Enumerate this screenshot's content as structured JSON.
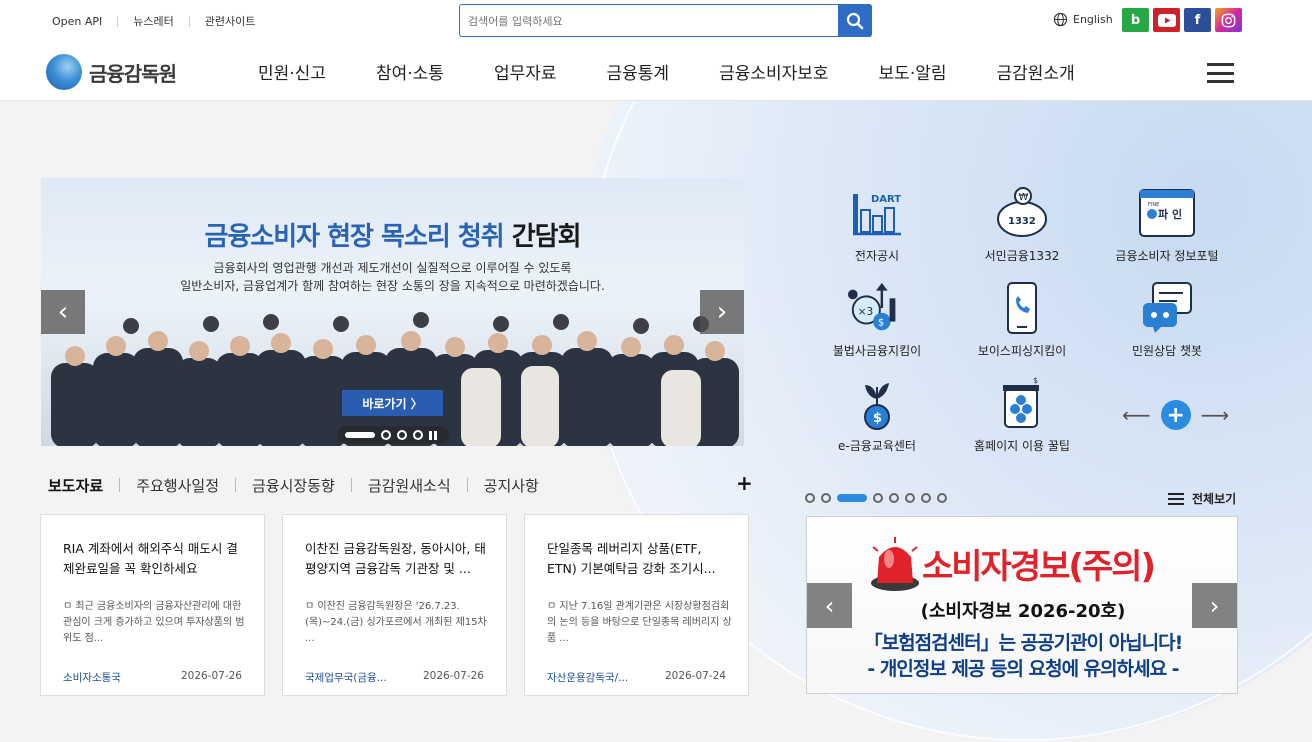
{
  "util_links": [
    "Open API",
    "뉴스레터",
    "관련사이트"
  ],
  "search": {
    "placeholder": "검색어를 입력하세요"
  },
  "language": "English",
  "sns": [
    "b",
    "youtube",
    "f",
    "instagram"
  ],
  "logo": {
    "text": "금융감독원"
  },
  "gnb": [
    "민원·신고",
    "참여·소통",
    "업무자료",
    "금융통계",
    "금융소비자보호",
    "보도·알림",
    "금감원소개"
  ],
  "banner": {
    "title_highlight": "금융소비자 현장 목소리 청취",
    "title_rest": " 간담회",
    "sub1": "금융회사의 영업관행 개선과 제도개선이 실질적으로 이루어질 수 있도록",
    "sub2": "일반소비자, 금융업계가 함께 참여하는 현장 소통의 장을 지속적으로 마련하겠습니다.",
    "go_label": "바로가기 〉"
  },
  "quick_services": [
    {
      "label": "전자공시",
      "icon": "dart-chart-icon"
    },
    {
      "label": "서민금융1332",
      "icon": "piggy-bank-icon"
    },
    {
      "label": "금융소비자 정보포털",
      "icon": "fine-portal-icon"
    },
    {
      "label": "불법사금융지킴이",
      "icon": "illegal-finance-icon"
    },
    {
      "label": "보이스피싱지킴이",
      "icon": "phone-icon"
    },
    {
      "label": "민원상담 챗봇",
      "icon": "chatbot-icon"
    },
    {
      "label": "e-금융교육센터",
      "icon": "plant-coin-icon"
    },
    {
      "label": "홈페이지 이용 꿀팁",
      "icon": "honey-jar-icon"
    }
  ],
  "tabs": [
    "보도자료",
    "주요행사일정",
    "금융시장동향",
    "금감원새소식",
    "공지사항"
  ],
  "news": [
    {
      "title": "RIA 계좌에서 해외주식 매도시 결제완료일을 꼭 확인하세요",
      "body": "ㅁ 최근 금융소비자의 금융자산관리에 대한 관심이 크게 증가하고 있으며 투자상품의 범위도 점...",
      "dept": "소비자소통국",
      "date": "2026-07-26"
    },
    {
      "title": "이찬진 금융감독원장, 동아시아, 태평양지역 금융감독 기관장 및 ...",
      "body": "ㅁ 이찬진 금융감독원장은 '26.7.23.(목)~24.(금) 싱가포르에서 개최된 제15차 ...",
      "dept": "국제업무국(금융...",
      "date": "2026-07-26"
    },
    {
      "title": "단일종목 레버리지 상품(ETF, ETN) 기본예탁금 강화 조기시...",
      "body": "ㅁ 지난 7.16일 관계기관은 시장상황점검회의 논의 등을 바탕으로 단일종목 레버리지 상품 ...",
      "dept": "자산운용감독국/...",
      "date": "2026-07-24"
    }
  ],
  "popup": {
    "all_label": "전체보기",
    "title": "소비자경보(주의)",
    "sub": "(소비자경보 2026-20호)",
    "line1": "「보험점검센터」는 공공기관이 아닙니다!",
    "line2": "- 개인정보 제공 등의 요청에 유의하세요 -"
  },
  "colors": {
    "accent": "#2f6cc4",
    "alert": "#e0232b",
    "navy": "#0d3e86"
  }
}
